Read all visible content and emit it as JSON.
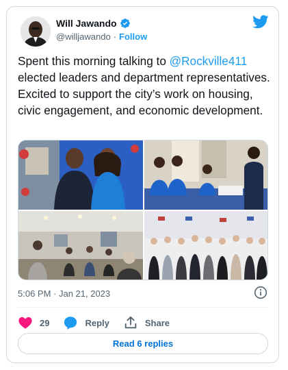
{
  "author": {
    "name": "Will Jawando",
    "handle": "@willjawando",
    "separator": "·",
    "follow_label": "Follow"
  },
  "icons": {
    "brand": "twitter-bird-icon",
    "verified": "verified-badge-icon",
    "info": "info-icon",
    "like": "heart-icon",
    "reply": "speech-bubble-icon",
    "share": "share-upload-icon"
  },
  "tweet": {
    "text_before": "Spent this morning talking to ",
    "mention": "@Rockville411",
    "text_after": " elected leaders and department representatives. Excited to support the city’s work on housing, civic engagement, and economic development."
  },
  "timestamp": "5:06 PM · Jan 21, 2023",
  "actions": {
    "like_count": "29",
    "reply_label": "Reply",
    "share_label": "Share"
  },
  "replies_button": "Read 6 replies",
  "colors": {
    "accent": "#1d9bf0",
    "like": "#f91880",
    "secondary_text": "#536471",
    "border": "#cfd9de"
  }
}
